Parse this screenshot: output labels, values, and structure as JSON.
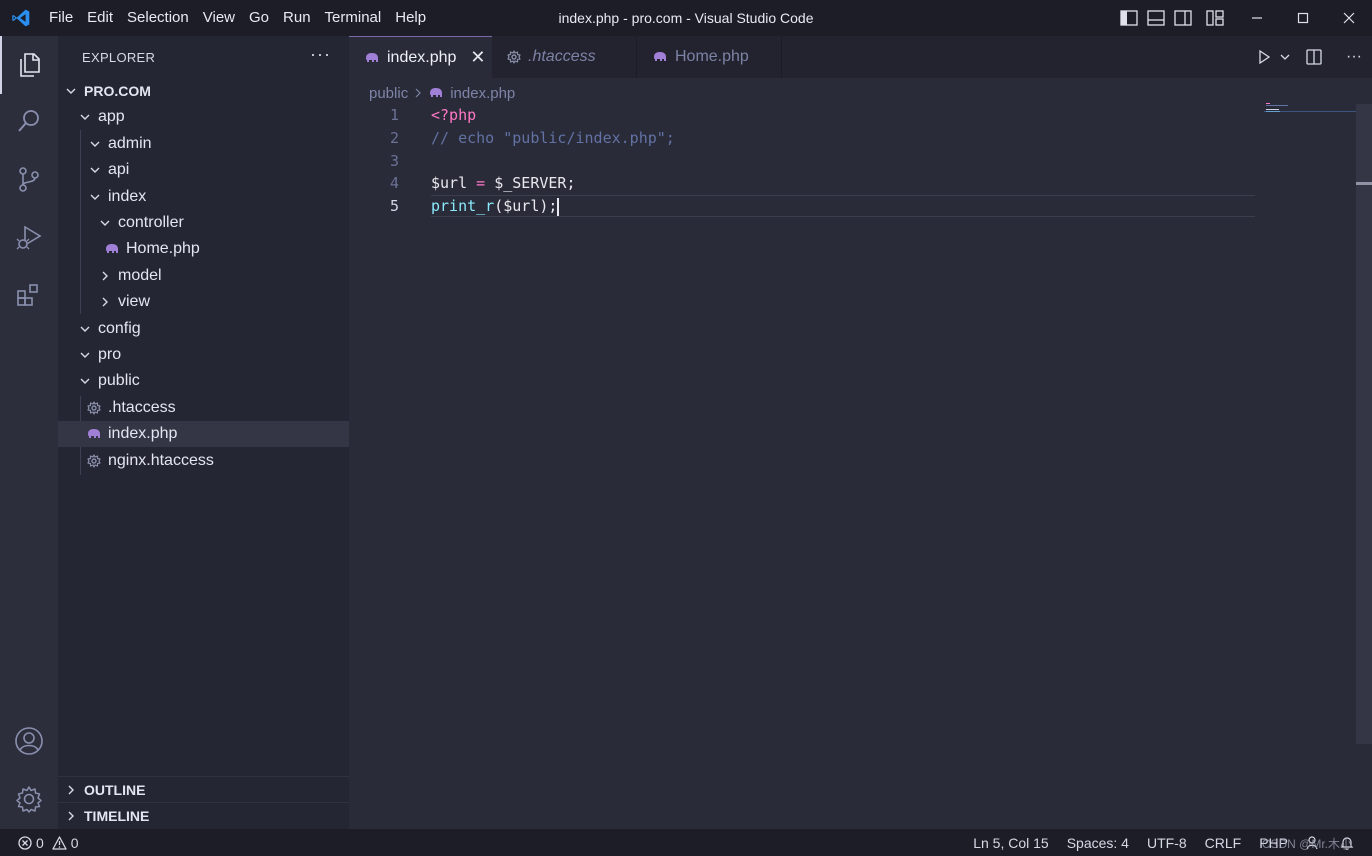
{
  "titlebar": {
    "menu": [
      "File",
      "Edit",
      "Selection",
      "View",
      "Go",
      "Run",
      "Terminal",
      "Help"
    ],
    "window_title": "index.php - pro.com - Visual Studio Code",
    "controls": [
      "toggle-primary-sidebar-icon",
      "toggle-panel-icon",
      "toggle-secondary-sidebar-icon",
      "customize-layout-icon"
    ],
    "window_buttons": [
      "minimize",
      "maximize",
      "close"
    ]
  },
  "activity_bar": {
    "items": [
      "explorer-icon",
      "search-icon",
      "source-control-icon",
      "run-debug-icon",
      "extensions-icon"
    ],
    "bottom": [
      "account-icon",
      "settings-gear-icon"
    ]
  },
  "sidebar": {
    "header": "EXPLORER",
    "more": "···",
    "root": "PRO.COM",
    "tree": [
      {
        "label": "app",
        "type": "folder",
        "open": true,
        "depth": 1
      },
      {
        "label": "admin",
        "type": "folder",
        "open": true,
        "depth": 2
      },
      {
        "label": "api",
        "type": "folder",
        "open": true,
        "depth": 2
      },
      {
        "label": "index",
        "type": "folder",
        "open": true,
        "depth": 2
      },
      {
        "label": "controller",
        "type": "folder",
        "open": true,
        "depth": 3
      },
      {
        "label": "Home.php",
        "type": "php",
        "depth": 4
      },
      {
        "label": "model",
        "type": "folder",
        "open": false,
        "depth": 3
      },
      {
        "label": "view",
        "type": "folder",
        "open": false,
        "depth": 3
      },
      {
        "label": "config",
        "type": "folder",
        "open": true,
        "depth": 1
      },
      {
        "label": "pro",
        "type": "folder",
        "open": true,
        "depth": 1
      },
      {
        "label": "public",
        "type": "folder",
        "open": true,
        "depth": 1
      },
      {
        "label": ".htaccess",
        "type": "gear",
        "depth": 2
      },
      {
        "label": "index.php",
        "type": "php",
        "depth": 2,
        "selected": true
      },
      {
        "label": "nginx.htaccess",
        "type": "gear",
        "depth": 2
      }
    ],
    "sections": [
      "OUTLINE",
      "TIMELINE"
    ]
  },
  "tabs": [
    {
      "label": "index.php",
      "icon": "php-elephant-icon",
      "active": true,
      "close": "✕"
    },
    {
      "label": ".htaccess",
      "icon": "gear-icon",
      "active": false,
      "italic": true
    },
    {
      "label": "Home.php",
      "icon": "php-elephant-icon",
      "active": false
    }
  ],
  "breadcrumb": [
    "public",
    "index.php"
  ],
  "code": {
    "lines": [
      {
        "n": "1",
        "tokens": [
          [
            "tk-tag",
            "<?php"
          ]
        ]
      },
      {
        "n": "2",
        "tokens": [
          [
            "tk-comment",
            "// echo \"public/index.php\";"
          ]
        ]
      },
      {
        "n": "3",
        "tokens": []
      },
      {
        "n": "4",
        "tokens": [
          [
            "tk-var",
            "$url"
          ],
          [
            "tk-punc",
            " "
          ],
          [
            "tk-op",
            "="
          ],
          [
            "tk-punc",
            " "
          ],
          [
            "tk-var",
            "$_SERVER"
          ],
          [
            "tk-punc",
            ";"
          ]
        ]
      },
      {
        "n": "5",
        "tokens": [
          [
            "tk-fn",
            "print_r"
          ],
          [
            "tk-punc",
            "("
          ],
          [
            "tk-var",
            "$url"
          ],
          [
            "tk-punc",
            ");"
          ]
        ],
        "current": true
      }
    ]
  },
  "statusbar": {
    "errors": "0",
    "warnings": "0",
    "position": "Ln 5, Col 15",
    "spaces": "Spaces: 4",
    "encoding": "UTF-8",
    "eol": "CRLF",
    "language": "PHP",
    "watermark": "CSDN @Mr.木小"
  },
  "colors": {
    "accent_php": "#a07fd6",
    "gear": "#8b90ab"
  }
}
